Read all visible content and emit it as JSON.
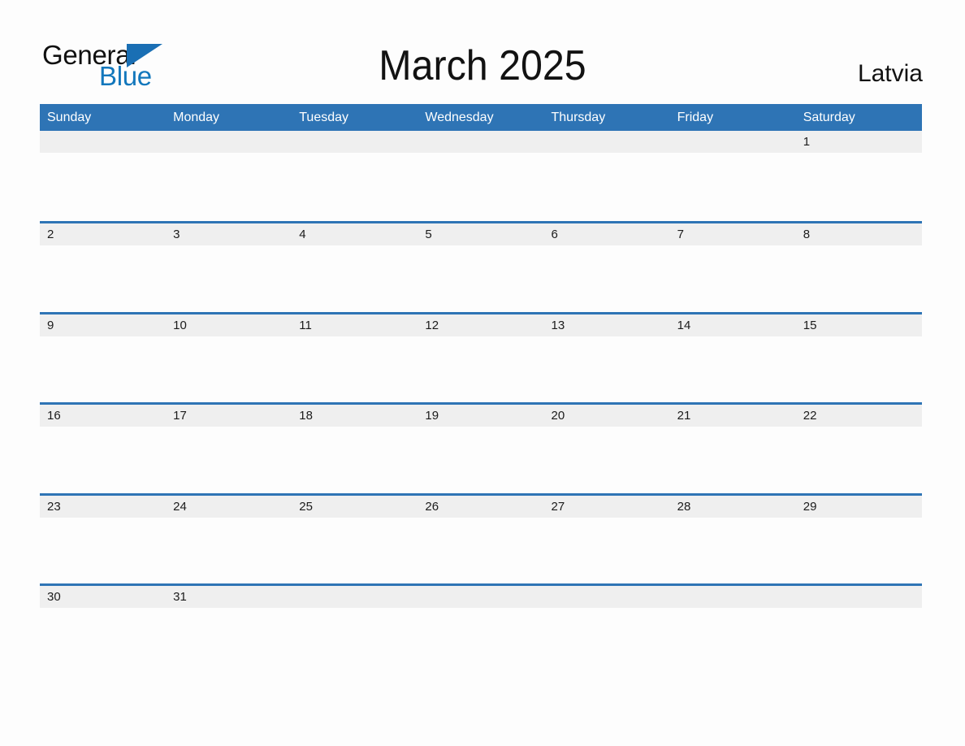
{
  "branding": {
    "logo_primary": "General",
    "logo_secondary": "Blue",
    "logo_triangle_icon": "triangle-icon",
    "accent_color": "#2e74b5",
    "logo_blue_color": "#1277bc",
    "band_color": "#efefef",
    "text_color": "#1b1b1b",
    "page_background": "#fdfdfd"
  },
  "header": {
    "title": "March 2025",
    "country": "Latvia"
  },
  "calendar": {
    "month": "March",
    "year": "2025",
    "weekdays": [
      "Sunday",
      "Monday",
      "Tuesday",
      "Wednesday",
      "Thursday",
      "Friday",
      "Saturday"
    ],
    "weeks": [
      [
        "",
        "",
        "",
        "",
        "",
        "",
        "1"
      ],
      [
        "2",
        "3",
        "4",
        "5",
        "6",
        "7",
        "8"
      ],
      [
        "9",
        "10",
        "11",
        "12",
        "13",
        "14",
        "15"
      ],
      [
        "16",
        "17",
        "18",
        "19",
        "20",
        "21",
        "22"
      ],
      [
        "23",
        "24",
        "25",
        "26",
        "27",
        "28",
        "29"
      ],
      [
        "30",
        "31",
        "",
        "",
        "",
        "",
        ""
      ]
    ]
  }
}
